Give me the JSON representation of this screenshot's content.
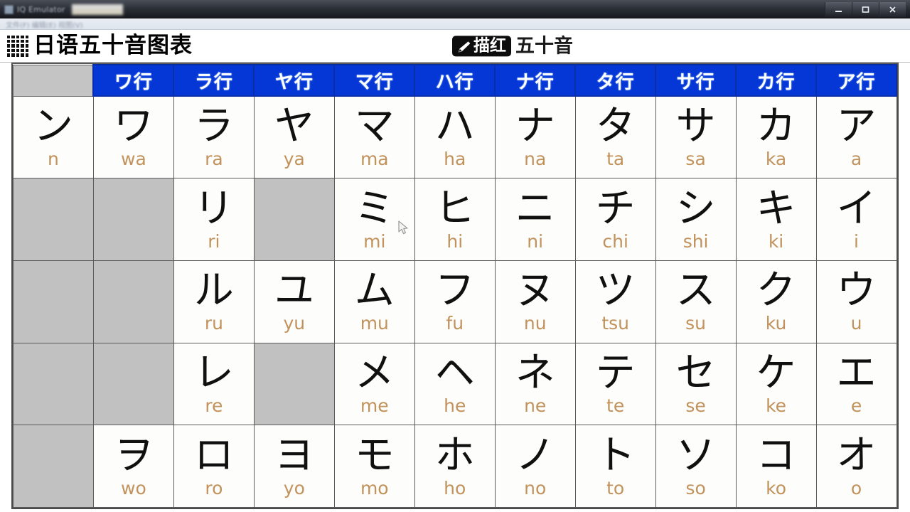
{
  "window": {
    "title": "IQ Emulator",
    "subbar_text": "文件(F) 编辑(E) 视图(V)",
    "controls": {
      "minimize": "Minimize",
      "maximize": "Maximize",
      "close": "Close"
    }
  },
  "header": {
    "icon": "dot-grid-icon",
    "title": "日语五十音图表",
    "badge_icon": "pen-icon",
    "badge_label": "描红",
    "center_label": "五十音"
  },
  "colors": {
    "header_blue": "#0536d6",
    "romaji": "#c2925c",
    "empty_cell": "#c1c1c1",
    "grid_line": "#5a5a5a"
  },
  "table": {
    "corner_label": "",
    "columns": [
      {
        "label": "ワ行"
      },
      {
        "label": "ラ行"
      },
      {
        "label": "ヤ行"
      },
      {
        "label": "マ行"
      },
      {
        "label": "ハ行"
      },
      {
        "label": "ナ行"
      },
      {
        "label": "タ行"
      },
      {
        "label": "サ行"
      },
      {
        "label": "カ行"
      },
      {
        "label": "ア行"
      }
    ],
    "rows": [
      {
        "cells": [
          {
            "kana": "ン",
            "romaji": "n",
            "empty": false
          },
          {
            "kana": "ワ",
            "romaji": "wa",
            "empty": false
          },
          {
            "kana": "ラ",
            "romaji": "ra",
            "empty": false
          },
          {
            "kana": "ヤ",
            "romaji": "ya",
            "empty": false
          },
          {
            "kana": "マ",
            "romaji": "ma",
            "empty": false
          },
          {
            "kana": "ハ",
            "romaji": "ha",
            "empty": false
          },
          {
            "kana": "ナ",
            "romaji": "na",
            "empty": false
          },
          {
            "kana": "タ",
            "romaji": "ta",
            "empty": false
          },
          {
            "kana": "サ",
            "romaji": "sa",
            "empty": false
          },
          {
            "kana": "カ",
            "romaji": "ka",
            "empty": false
          },
          {
            "kana": "ア",
            "romaji": "a",
            "empty": false
          }
        ]
      },
      {
        "cells": [
          {
            "kana": "",
            "romaji": "",
            "empty": true
          },
          {
            "kana": "",
            "romaji": "",
            "empty": true
          },
          {
            "kana": "リ",
            "romaji": "ri",
            "empty": false
          },
          {
            "kana": "",
            "romaji": "",
            "empty": true
          },
          {
            "kana": "ミ",
            "romaji": "mi",
            "empty": false
          },
          {
            "kana": "ヒ",
            "romaji": "hi",
            "empty": false
          },
          {
            "kana": "ニ",
            "romaji": "ni",
            "empty": false
          },
          {
            "kana": "チ",
            "romaji": "chi",
            "empty": false
          },
          {
            "kana": "シ",
            "romaji": "shi",
            "empty": false
          },
          {
            "kana": "キ",
            "romaji": "ki",
            "empty": false
          },
          {
            "kana": "イ",
            "romaji": "i",
            "empty": false
          }
        ]
      },
      {
        "cells": [
          {
            "kana": "",
            "romaji": "",
            "empty": true
          },
          {
            "kana": "",
            "romaji": "",
            "empty": true
          },
          {
            "kana": "ル",
            "romaji": "ru",
            "empty": false
          },
          {
            "kana": "ユ",
            "romaji": "yu",
            "empty": false
          },
          {
            "kana": "ム",
            "romaji": "mu",
            "empty": false
          },
          {
            "kana": "フ",
            "romaji": "fu",
            "empty": false
          },
          {
            "kana": "ヌ",
            "romaji": "nu",
            "empty": false
          },
          {
            "kana": "ツ",
            "romaji": "tsu",
            "empty": false
          },
          {
            "kana": "ス",
            "romaji": "su",
            "empty": false
          },
          {
            "kana": "ク",
            "romaji": "ku",
            "empty": false
          },
          {
            "kana": "ウ",
            "romaji": "u",
            "empty": false
          }
        ]
      },
      {
        "cells": [
          {
            "kana": "",
            "romaji": "",
            "empty": true
          },
          {
            "kana": "",
            "romaji": "",
            "empty": true
          },
          {
            "kana": "レ",
            "romaji": "re",
            "empty": false
          },
          {
            "kana": "",
            "romaji": "",
            "empty": true
          },
          {
            "kana": "メ",
            "romaji": "me",
            "empty": false
          },
          {
            "kana": "ヘ",
            "romaji": "he",
            "empty": false
          },
          {
            "kana": "ネ",
            "romaji": "ne",
            "empty": false
          },
          {
            "kana": "テ",
            "romaji": "te",
            "empty": false
          },
          {
            "kana": "セ",
            "romaji": "se",
            "empty": false
          },
          {
            "kana": "ケ",
            "romaji": "ke",
            "empty": false
          },
          {
            "kana": "エ",
            "romaji": "e",
            "empty": false
          }
        ]
      },
      {
        "cells": [
          {
            "kana": "",
            "romaji": "",
            "empty": true
          },
          {
            "kana": "ヲ",
            "romaji": "wo",
            "empty": false
          },
          {
            "kana": "ロ",
            "romaji": "ro",
            "empty": false
          },
          {
            "kana": "ヨ",
            "romaji": "yo",
            "empty": false
          },
          {
            "kana": "モ",
            "romaji": "mo",
            "empty": false
          },
          {
            "kana": "ホ",
            "romaji": "ho",
            "empty": false
          },
          {
            "kana": "ノ",
            "romaji": "no",
            "empty": false
          },
          {
            "kana": "ト",
            "romaji": "to",
            "empty": false
          },
          {
            "kana": "ソ",
            "romaji": "so",
            "empty": false
          },
          {
            "kana": "コ",
            "romaji": "ko",
            "empty": false
          },
          {
            "kana": "オ",
            "romaji": "o",
            "empty": false
          }
        ]
      }
    ]
  }
}
